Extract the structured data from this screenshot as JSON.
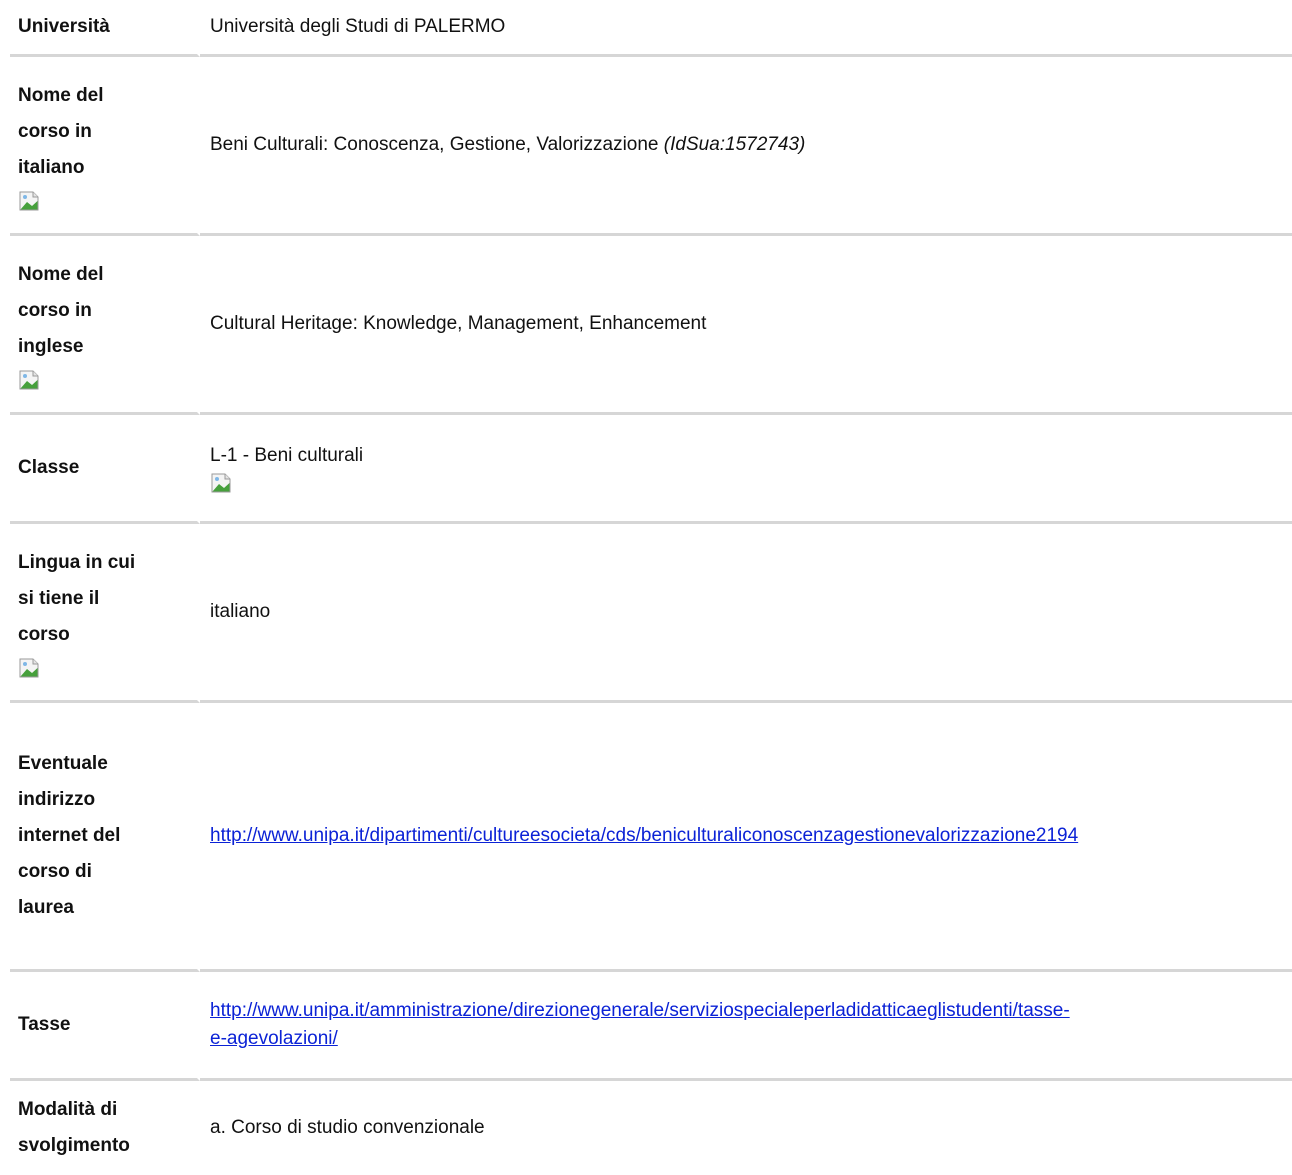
{
  "rows": {
    "universita": {
      "label": "Università",
      "value": "Università degli Studi di PALERMO"
    },
    "nome_italiano": {
      "label_lines": [
        "Nome del",
        "corso in",
        "italiano"
      ],
      "value": "Beni Culturali: Conoscenza, Gestione, Valorizzazione",
      "idsua": "(IdSua:1572743)"
    },
    "nome_inglese": {
      "label_lines": [
        "Nome del",
        "corso in",
        "inglese"
      ],
      "value": "Cultural Heritage: Knowledge, Management, Enhancement"
    },
    "classe": {
      "label": "Classe",
      "value": "L-1 - Beni culturali"
    },
    "lingua": {
      "label_lines": [
        "Lingua in cui",
        "si tiene il",
        "corso"
      ],
      "value": "italiano"
    },
    "indirizzo": {
      "label_lines": [
        "Eventuale",
        "indirizzo",
        "internet del",
        "corso di",
        "laurea"
      ],
      "link": "http://www.unipa.it/dipartimenti/cultureesocieta/cds/beniculturaliconoscenzagestionevalorizzazione2194"
    },
    "tasse": {
      "label": "Tasse",
      "link_line1": "http://www.unipa.it/amministrazione/direzionegenerale/serviziospecialeperladidatticaeglistudenti/tasse-",
      "link_line2": "e-agevolazioni/"
    },
    "modalita": {
      "label_lines": [
        "Modalità di",
        "svolgimento"
      ],
      "value": "a. Corso di studio convenzionale"
    }
  },
  "icons": {
    "broken_image": "broken-image-icon"
  }
}
